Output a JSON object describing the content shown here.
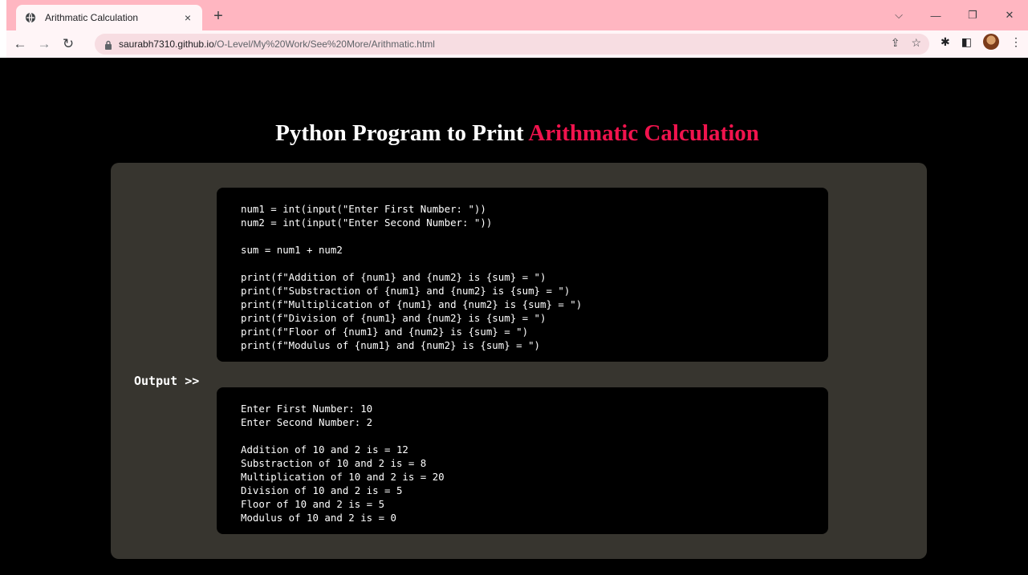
{
  "browser": {
    "tab_title": "Arithmatic Calculation",
    "tab_close": "×",
    "new_tab": "+",
    "url_host": "saurabh7310.github.io",
    "url_path": "/O-Level/My%20Work/See%20More/Arithmatic.html"
  },
  "page": {
    "heading_plain": "Python Program to Print ",
    "heading_accent": "Arithmatic Calculation",
    "accent_color": "#f0134d",
    "panel_color": "#37352f",
    "output_label": "Output >>"
  },
  "code": {
    "input_lines": [
      "num1 = int(input(\"Enter First Number: \"))",
      "num2 = int(input(\"Enter Second Number: \"))"
    ],
    "calc_line": "sum = num1 + num2",
    "print_lines": [
      "print(f\"Addition of {num1} and {num2} is {sum} = \")",
      "print(f\"Substraction of {num1} and {num2} is {sum} = \")",
      "print(f\"Multiplication of {num1} and {num2} is {sum} = \")",
      "print(f\"Division of {num1} and {num2} is {sum} = \")",
      "print(f\"Floor of {num1} and {num2} is {sum} = \")",
      "print(f\"Modulus of {num1} and {num2} is {sum} = \")"
    ]
  },
  "output": {
    "input_lines": [
      "Enter First Number: 10",
      "Enter Second Number: 2"
    ],
    "result_lines": [
      "Addition of 10 and 2 is = 12",
      "Substraction of 10 and 2 is = 8",
      "Multiplication of 10 and 2 is = 20",
      "Division of 10 and 2 is = 5",
      "Floor of 10 and 2 is = 5",
      "Modulus of 10 and 2 is = 0"
    ]
  }
}
